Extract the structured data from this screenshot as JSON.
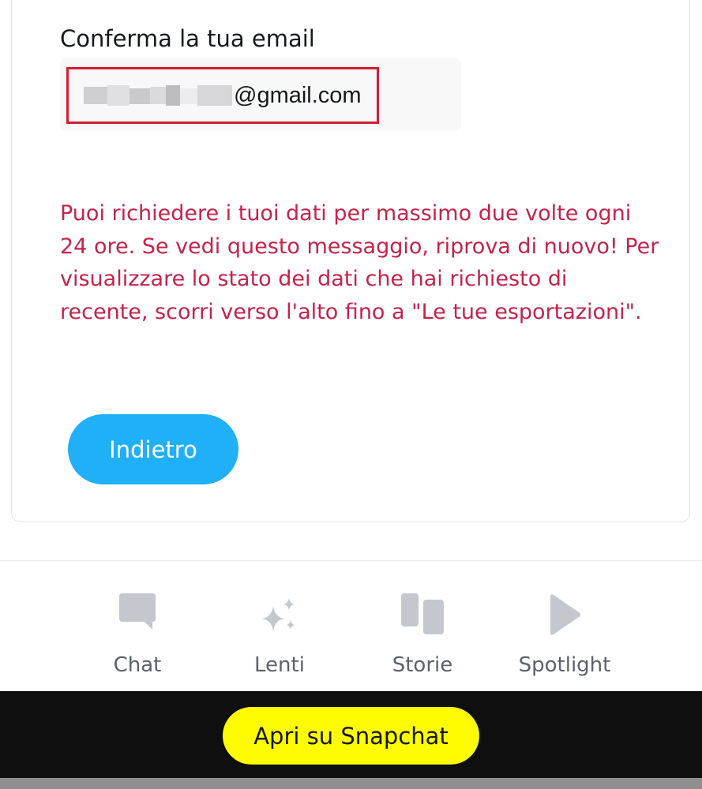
{
  "form": {
    "email_label": "Conferma la tua email",
    "email_value_visible": "@gmail.com",
    "error_message": "Puoi richiedere i tuoi dati per massimo due volte ogni 24 ore. Se vedi questo messaggio, riprova di nuovo! Per visualizzare lo stato dei dati che hai richiesto di recente, scorri verso l'alto fino a \"Le tue esportazioni\".",
    "back_label": "Indietro"
  },
  "bottom_nav": {
    "items": [
      {
        "label": "Chat",
        "icon": "chat-icon"
      },
      {
        "label": "Lenti",
        "icon": "sparkles-icon"
      },
      {
        "label": "Storie",
        "icon": "stories-icon"
      },
      {
        "label": "Spotlight",
        "icon": "play-icon"
      }
    ]
  },
  "cta": {
    "open_label": "Apri su Snapchat"
  },
  "colors": {
    "error": "#c4234a",
    "primary_button": "#1fb0f7",
    "snapchat_yellow": "#fffc00",
    "highlight_box": "#d01f2d",
    "nav_icon": "#c4c8ce"
  }
}
